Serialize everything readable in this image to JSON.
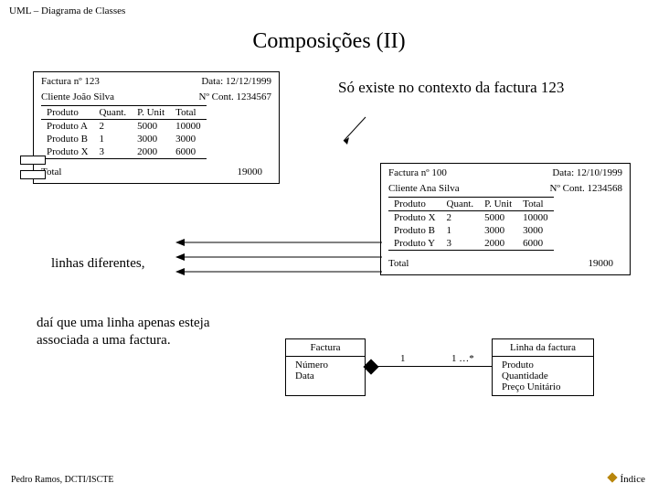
{
  "header": "UML – Diagrama de Classes",
  "title": "Composições (II)",
  "invoice_left": {
    "fact_label": "Factura  nº 123",
    "date_label": "Data: 12/12/1999",
    "client_label": "Cliente João Silva",
    "cont_label": "Nº Cont. 1234567",
    "cols": [
      "Produto",
      "Quant.",
      "P. Unit",
      "Total"
    ],
    "rows": [
      {
        "p": "Produto A",
        "q": "2",
        "pu": "5000",
        "t": "10000"
      },
      {
        "p": "Produto B",
        "q": "1",
        "pu": "3000",
        "t": "3000"
      },
      {
        "p": "Produto X",
        "q": "3",
        "pu": "2000",
        "t": "6000"
      }
    ],
    "foot_label": "Total",
    "foot_total": "19000"
  },
  "invoice_right": {
    "fact_label": "Factura  nº 100",
    "date_label": "Data: 12/10/1999",
    "client_label": "Cliente Ana Silva",
    "cont_label": "Nº Cont. 1234568",
    "cols": [
      "Produto",
      "Quant.",
      "P. Unit",
      "Total"
    ],
    "rows": [
      {
        "p": "Produto X",
        "q": "2",
        "pu": "5000",
        "t": "10000"
      },
      {
        "p": "Produto B",
        "q": "1",
        "pu": "3000",
        "t": "3000"
      },
      {
        "p": "Produto Y",
        "q": "3",
        "pu": "2000",
        "t": "6000"
      }
    ],
    "foot_label": "Total",
    "foot_total": "19000"
  },
  "note_top": "Só existe no contexto da factura 123",
  "note_mid": "linhas diferentes,",
  "note_bottom": "daí que uma linha apenas esteja associada a uma factura.",
  "uml": {
    "left_name": "Factura",
    "left_attrs": "Número\nData",
    "right_name": "Linha da factura",
    "right_attrs": "Produto\nQuantidade\nPreço Unitário",
    "mult_left": "1",
    "mult_right": "1 …*"
  },
  "footer_left": "Pedro Ramos, DCTI/ISCTE",
  "footer_right": "Índice",
  "chart_data": [
    {
      "type": "table",
      "title": "Factura nº 123 — Cliente João Silva — Data 12/12/1999 — Nº Cont. 1234567",
      "columns": [
        "Produto",
        "Quant.",
        "P. Unit",
        "Total"
      ],
      "rows": [
        [
          "Produto A",
          2,
          5000,
          10000
        ],
        [
          "Produto B",
          1,
          3000,
          3000
        ],
        [
          "Produto X",
          3,
          2000,
          6000
        ]
      ],
      "footer": [
        "Total",
        "",
        "",
        19000
      ]
    },
    {
      "type": "table",
      "title": "Factura nº 100 — Cliente Ana Silva — Data 12/10/1999 — Nº Cont. 1234568",
      "columns": [
        "Produto",
        "Quant.",
        "P. Unit",
        "Total"
      ],
      "rows": [
        [
          "Produto X",
          2,
          5000,
          10000
        ],
        [
          "Produto B",
          1,
          3000,
          3000
        ],
        [
          "Produto Y",
          3,
          2000,
          6000
        ]
      ],
      "footer": [
        "Total",
        "",
        "",
        19000
      ]
    }
  ]
}
